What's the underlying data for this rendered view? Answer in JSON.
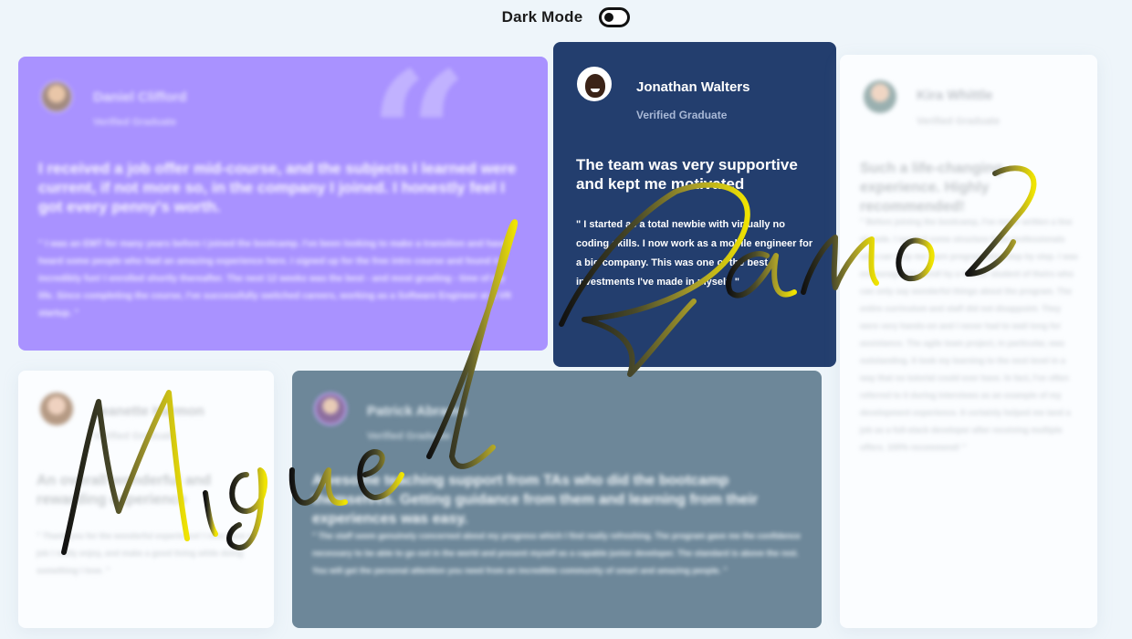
{
  "header": {
    "dark_mode_label": "Dark Mode",
    "dark_mode_enabled": false
  },
  "testimonials": [
    {
      "name": "Daniel Clifford",
      "role": "Verified Graduate",
      "headline": "I received a job offer mid-course, and the subjects I learned were current, if not more so, in the company I joined. I honestly feel I got every penny's worth.",
      "body": "\" I was an EMT for many years before I joined the bootcamp. I've been looking to make a transition and have heard some people who had an amazing experience here. I signed up for the free intro course and found it incredibly fun! I enrolled shortly thereafter. The next 12 weeks was the best - and most grueling - time of my life. Since completing the course, I've successfully switched careers, working as a Software Engineer at a VR startup. \"",
      "color": "#a992ff"
    },
    {
      "name": "Jonathan Walters",
      "role": "Verified Graduate",
      "headline": "The team was very supportive and kept me motivated",
      "body": "\" I started as a total newbie with virtually no coding skills. I now work as a mobile engineer for a big company. This was one of the best investments I've made in myself. \"",
      "color": "#233e6e"
    },
    {
      "name": "Kira Whittle",
      "role": "Verified Graduate",
      "headline": "Such a life-changing experience. Highly recommended!",
      "body": "\" Before joining the bootcamp, I've never written a line of code. I needed some structure from professionals who can help me learn programming step by step. I was encouraged to enroll by a former student of theirs who can only say wonderful things about the program. The entire curriculum and staff did not disappoint. They were very hands-on and I never had to wait long for assistance. The agile team project, in particular, was outstanding. It took my learning to the next level in a way that no tutorial could ever have. In fact, I've often referred to it during interviews as an example of my development experience. It certainly helped me land a job as a full-stack developer after receiving multiple offers. 100% recommend! \"",
      "color": "#fbfdff"
    },
    {
      "name": "Jeanette Harmon",
      "role": "Verified Graduate",
      "headline": "An overall wonderful and rewarding experience",
      "body": "\" Thank you for the wonderful experience! I now have a job I really enjoy, and make a good living while doing something I love. \"",
      "color": "#fbfdff"
    },
    {
      "name": "Patrick Abrams",
      "role": "Verified Graduate",
      "headline": "Awesome teaching support from TAs who did the bootcamp themselves. Getting guidance from them and learning from their experiences was easy.",
      "body": "\" The staff seem genuinely concerned about my progress which I find really refreshing. The program gave me the confidence necessary to be able to go out in the world and present myself as a capable junior developer. The standard is above the rest. You will get the personal attention you need from an incredible community of smart and amazing people. \"",
      "color": "#6d8799"
    }
  ],
  "overlay_signature": {
    "text": "Miguel Ramos",
    "color_start": "#111111",
    "color_end": "#f0e400"
  }
}
